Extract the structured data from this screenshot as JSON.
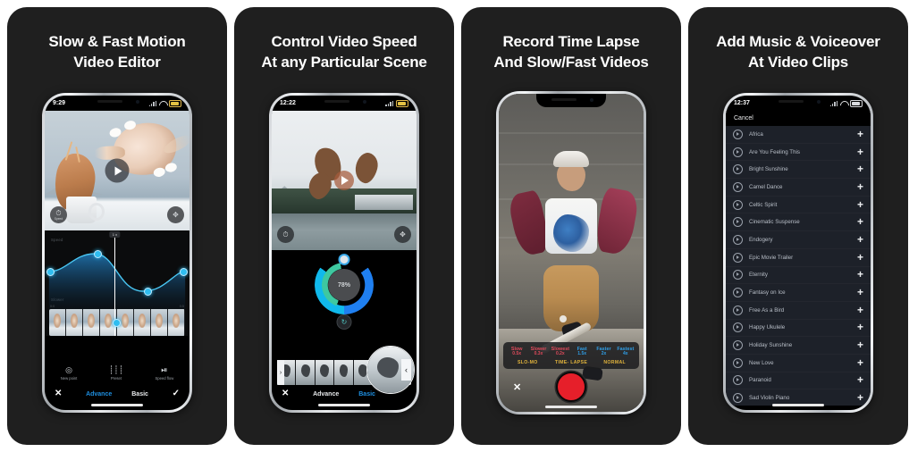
{
  "meta": {
    "background": "#ffffff",
    "panel_bg": "#1f1f1f",
    "accent_blue": "#1e8fe0",
    "accent_cyan": "#2fbdf0",
    "accent_green": "#3ec8a0",
    "accent_red": "#e61f2a",
    "accent_yellow": "#e0b23c"
  },
  "panels": [
    {
      "headline_line1": "Slow & Fast Motion",
      "headline_line2": "Video Editor",
      "status": {
        "time": "9:29",
        "signal_icon": "signal-bars-icon",
        "wifi_icon": "wifi-icon",
        "battery_icon": "battery-icon"
      },
      "preview": {
        "play_icon": "play-icon",
        "left_overlay": {
          "icon": "speed-icon",
          "label": "Speed"
        },
        "right_overlay": {
          "icon": "fullscreen-icon"
        }
      },
      "curve": {
        "top_label": "Speed",
        "bottom_label": "Slower",
        "playhead_tag": "1 x",
        "time_start": "0:0",
        "time_end": "0:5",
        "points": [
          {
            "x": 3,
            "y": 52
          },
          {
            "x": 35,
            "y": 30
          },
          {
            "x": 68,
            "y": 76
          },
          {
            "x": 97,
            "y": 52
          }
        ]
      },
      "tools": [
        {
          "icon": "add-point-icon",
          "label": "New point"
        },
        {
          "icon": "preset-icon",
          "label": "Preset"
        },
        {
          "icon": "speed-flow-icon",
          "label": "Speed flow"
        }
      ],
      "tabs": [
        {
          "label": "Advance",
          "active": true
        },
        {
          "label": "Basic",
          "active": false
        }
      ],
      "close_icon": "close-icon",
      "confirm_icon": "checkmark-icon"
    },
    {
      "headline_line1": "Control Video Speed",
      "headline_line2": "At any Particular Scene",
      "status": {
        "time": "12:22",
        "signal_icon": "signal-bars-icon",
        "battery_icon": "battery-icon"
      },
      "preview": {
        "play_icon": "play-icon",
        "left_overlay": {
          "icon": "speed-icon"
        },
        "right_overlay": {
          "icon": "fullscreen-icon"
        }
      },
      "dial": {
        "value_label": "78%",
        "value_percent": 78,
        "reset_icon": "reset-icon",
        "knob_icon": "dial-knob"
      },
      "timeline": {
        "left_handle": "›",
        "right_handle": "‹",
        "magnifier_handle": "‹"
      },
      "tabs": [
        {
          "label": "Advance",
          "active": false
        },
        {
          "label": "Basic",
          "active": true
        }
      ],
      "close_icon": "close-icon"
    },
    {
      "headline_line1": "Record Time Lapse",
      "headline_line2": "And Slow/Fast Videos",
      "speeds": [
        {
          "name": "Slow",
          "value": "0.5x",
          "kind": "slow"
        },
        {
          "name": "Slower",
          "value": "0.3x",
          "kind": "slow"
        },
        {
          "name": "Slowest",
          "value": "0.2x",
          "kind": "slow"
        },
        {
          "name": "Fast",
          "value": "1.5x",
          "kind": "fast"
        },
        {
          "name": "Faster",
          "value": "2x",
          "kind": "fast"
        },
        {
          "name": "Fastest",
          "value": "4x",
          "kind": "fast"
        }
      ],
      "modes": [
        "SLO-MO",
        "TIME- LAPSE",
        "NORMAL"
      ],
      "record_icon": "record-button",
      "close_icon": "close-icon"
    },
    {
      "headline_line1": "Add Music & Voiceover",
      "headline_line2": "At Video Clips",
      "status": {
        "time": "12:37",
        "signal_icon": "signal-bars-icon",
        "wifi_icon": "wifi-icon",
        "battery_icon": "battery-icon"
      },
      "cancel_label": "Cancel",
      "play_icon": "play-circle-icon",
      "add_icon": "plus-icon",
      "tracks": [
        "Africa",
        "Are You Feeling This",
        "Bright Sunshine",
        "Camel Dance",
        "Celtic Spirit",
        "Cinematic Suspense",
        "Endogery",
        "Epic Movie Trailer",
        "Eternity",
        "Fantasy on Ice",
        "Free As a Bird",
        "Happy Ukulele",
        "Holiday Sunshine",
        "New Love",
        "Paranoid",
        "Sad Violin  Piano"
      ]
    }
  ]
}
